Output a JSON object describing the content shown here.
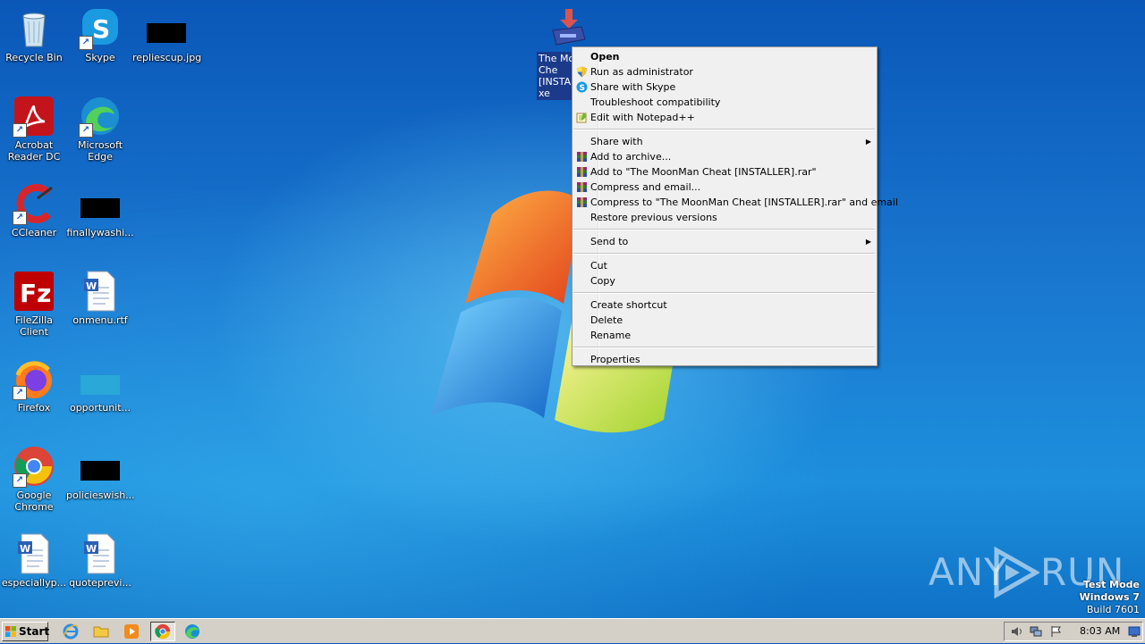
{
  "desktop": {
    "icons": [
      {
        "label": "Recycle Bin",
        "icon": "recycle-bin-icon"
      },
      {
        "label": "Skype",
        "icon": "skype-icon"
      },
      {
        "label": "repliescup.jpg",
        "icon": "image-file-icon"
      },
      {
        "label": "Acrobat\nReader DC",
        "label_l1": "Acrobat",
        "label_l2": "Reader DC",
        "icon": "acrobat-icon"
      },
      {
        "label": "Microsoft Edge",
        "icon": "edge-icon"
      },
      {
        "label": "CCleaner",
        "icon": "ccleaner-icon"
      },
      {
        "label": "finallywashi...",
        "icon": "image-file-icon"
      },
      {
        "label": "FileZilla Client",
        "icon": "filezilla-icon"
      },
      {
        "label": "onmenu.rtf",
        "icon": "word-document-icon"
      },
      {
        "label": "Firefox",
        "icon": "firefox-icon"
      },
      {
        "label": "opportunit...",
        "icon": "image-file-icon"
      },
      {
        "label": "Google Chrome",
        "label_l1": "Google",
        "label_l2": "Chrome",
        "icon": "chrome-icon"
      },
      {
        "label": "policieswish...",
        "icon": "image-file-icon"
      },
      {
        "label": "especiallyp...",
        "icon": "word-document-icon"
      },
      {
        "label": "quotepreви...",
        "label_display": "quoteprevi...",
        "icon": "word-document-icon"
      }
    ],
    "selected_item": {
      "label_lines": [
        "The Mo",
        "Che",
        "[INSTAL",
        "xe"
      ],
      "icon": "installer-icon"
    }
  },
  "context_menu": {
    "groups": [
      [
        {
          "label": "Open",
          "bold": true
        },
        {
          "label": "Run as administrator",
          "icon": "uac-shield-icon"
        },
        {
          "label": "Share with Skype",
          "icon": "skype-icon"
        },
        {
          "label": "Troubleshoot compatibility"
        },
        {
          "label": "Edit with Notepad++",
          "icon": "notepad-plus-plus-icon"
        }
      ],
      [
        {
          "label": "Share with",
          "submenu": true
        },
        {
          "label": "Add to archive...",
          "icon": "winrar-icon"
        },
        {
          "label": "Add to \"The MoonMan Cheat [INSTALLER].rar\"",
          "icon": "winrar-icon"
        },
        {
          "label": "Compress and email...",
          "icon": "winrar-icon"
        },
        {
          "label": "Compress to \"The MoonMan Cheat [INSTALLER].rar\" and email",
          "icon": "winrar-icon"
        },
        {
          "label": "Restore previous versions"
        }
      ],
      [
        {
          "label": "Send to",
          "submenu": true
        }
      ],
      [
        {
          "label": "Cut"
        },
        {
          "label": "Copy"
        }
      ],
      [
        {
          "label": "Create shortcut"
        },
        {
          "label": "Delete"
        },
        {
          "label": "Rename"
        }
      ],
      [
        {
          "label": "Properties"
        }
      ]
    ]
  },
  "watermark": {
    "left": "ANY",
    "right": "RUN"
  },
  "system_info": {
    "line1": "Test Mode",
    "line2": "Windows 7",
    "line3": "Build 7601"
  },
  "taskbar": {
    "start_label": "Start",
    "pinned": [
      "internet-explorer-icon",
      "file-explorer-icon",
      "media-player-icon",
      "chrome-icon",
      "edge-icon"
    ],
    "active_index": 3,
    "clock": "8:03 AM",
    "tray_icons": [
      "speaker-icon",
      "network-icon",
      "action-center-flag-icon",
      "show-desktop-icon"
    ]
  },
  "colors": {
    "menu_bg": "#f0f0f0",
    "selection": "#1b3a8a",
    "taskbar": "#d4d0c8"
  }
}
